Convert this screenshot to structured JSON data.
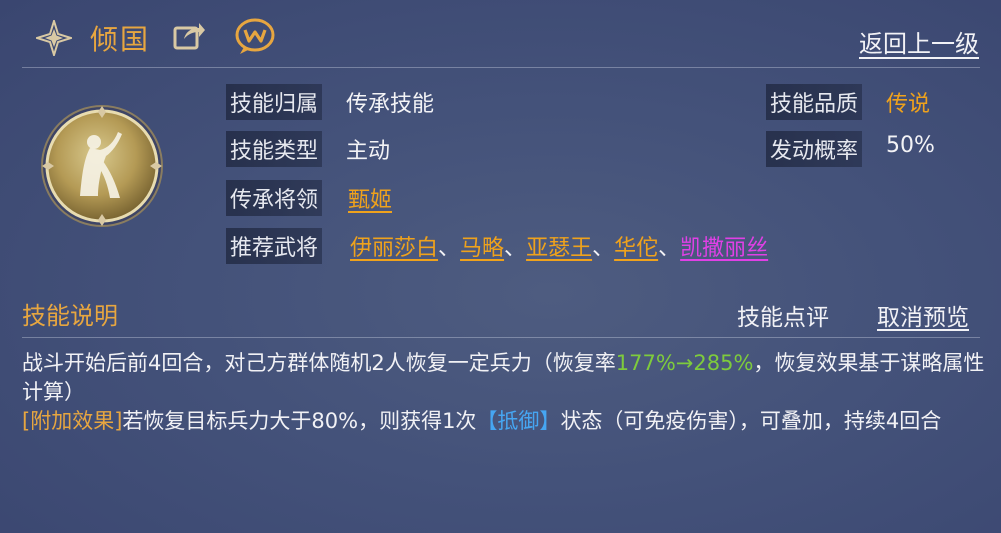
{
  "header": {
    "skill_name": "倾国",
    "back_link": "返回上一级",
    "icons": [
      "diamond-star-icon",
      "share-icon",
      "chat-icon"
    ]
  },
  "info": {
    "belong_label": "技能归属",
    "belong_value": "传承技能",
    "type_label": "技能类型",
    "type_value": "主动",
    "general_label": "传承将领",
    "general_value": "甄姬",
    "recommend_label": "推荐武将",
    "recommend": [
      {
        "name": "伊丽莎白",
        "color": "#efa21c"
      },
      {
        "name": "马略",
        "color": "#efa21c"
      },
      {
        "name": "亚瑟王",
        "color": "#efa21c"
      },
      {
        "name": "华佗",
        "color": "#efa21c"
      },
      {
        "name": "凯撒丽丝",
        "color": "#e040e6"
      }
    ],
    "separator": "、",
    "quality_label": "技能品质",
    "quality_value": "传说",
    "chance_label": "发动概率",
    "chance_value": "50%"
  },
  "section": {
    "title": "技能说明",
    "review_button": "技能点评",
    "cancel_preview_button": "取消预览"
  },
  "description": {
    "line1_pre": "战斗开始后前4回合，对己方群体随机2人恢复一定兵力（恢复率",
    "rate": "177%→285%",
    "line1_post": "，恢复效果基于谋略属性计算）",
    "extra_tag": "[附加效果]",
    "line2_pre": "若恢复目标兵力大于80%，则获得1次",
    "status_tag": "【抵御】",
    "line2_post": "状态（可免疫伤害），可叠加，持续4回合"
  },
  "colors": {
    "accent_gold": "#efa21c",
    "title_gold": "#e7a640",
    "green": "#7ecb3c",
    "blue": "#46a6f2",
    "pink": "#e040e6",
    "background": "#44527a"
  }
}
